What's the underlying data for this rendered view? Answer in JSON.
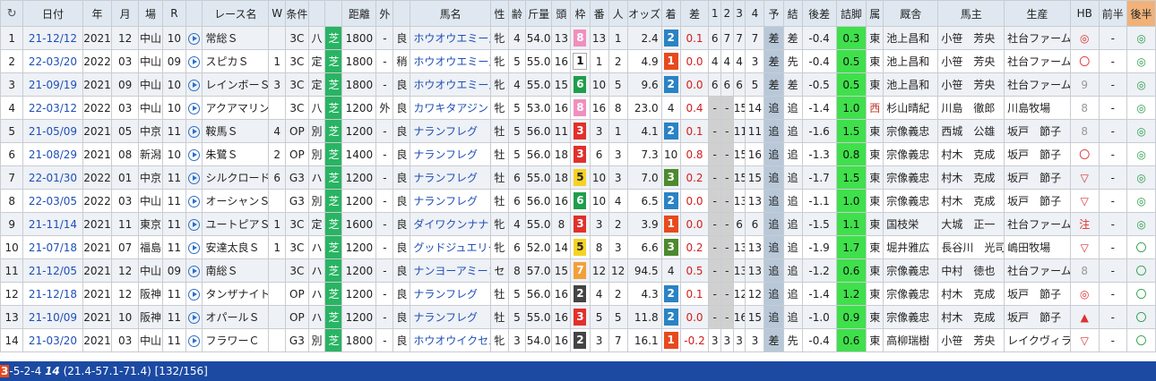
{
  "headers": {
    "refresh": "↻",
    "date": "日付",
    "year": "年",
    "month": "月",
    "place": "場",
    "race": "R",
    "race_name": "レース名",
    "w": "W",
    "cond": "条件",
    "course": "",
    "dist": "距離",
    "out": "外",
    "state": "",
    "horse": "馬名",
    "sex": "性",
    "age": "齢",
    "weight": "斤量",
    "heads": "頭",
    "waku": "枠",
    "num": "番",
    "ninki": "人",
    "odds": "オッズ",
    "chaku": "着",
    "sa": "差",
    "p1": "1",
    "p2": "2",
    "p3": "3",
    "p4": "4",
    "yoso": "予",
    "ketsu": "結",
    "kohan": "後差",
    "tsume": "詰脚",
    "zoku": "属",
    "kyusha": "厩舎",
    "owner": "馬主",
    "breeder": "生産",
    "hb": "HB",
    "zenhan": "前半",
    "kohan2": "後半"
  },
  "rows": [
    {
      "n": "1",
      "date": "21-12/12",
      "year": "2021",
      "month": "12",
      "place": "中山",
      "race": "10",
      "name": "常総Ｓ",
      "w": "",
      "cond": "3C",
      "ryo": "八",
      "course": "芝",
      "dist": "1800",
      "out": "-",
      "state": "良",
      "horse": "ホウオウエミーズ",
      "sex": "牝",
      "age": "4",
      "kin": "54.0",
      "heads": "13",
      "waku": "8",
      "num": "13",
      "ninki": "1",
      "odds": "2.4",
      "chaku": "2",
      "sa": "0.1",
      "p1": "6",
      "p2": "7",
      "p3": "7",
      "p4": "7",
      "yoso": "差",
      "ketsu": "差",
      "kohan": "-0.4",
      "tsume": "0.3",
      "zoku": "東",
      "kyusha": "池上昌和",
      "owner": "小笹　芳央",
      "breeder": "社台ファーム",
      "hb": "◎",
      "zenhan": "-",
      "kohan2": "◎"
    },
    {
      "n": "2",
      "date": "22-03/20",
      "year": "2022",
      "month": "03",
      "place": "中山",
      "race": "09",
      "name": "スピカＳ",
      "w": "1",
      "cond": "3C",
      "ryo": "定",
      "course": "芝",
      "dist": "1800",
      "out": "-",
      "state": "稍",
      "horse": "ホウオウエミーズ",
      "sex": "牝",
      "age": "5",
      "kin": "55.0",
      "heads": "16",
      "waku": "1",
      "num": "1",
      "ninki": "2",
      "odds": "4.9",
      "chaku": "1",
      "sa": "0.0",
      "p1": "4",
      "p2": "4",
      "p3": "4",
      "p4": "3",
      "yoso": "差",
      "ketsu": "先",
      "kohan": "-0.4",
      "tsume": "0.5",
      "zoku": "東",
      "kyusha": "池上昌和",
      "owner": "小笹　芳央",
      "breeder": "社台ファーム",
      "hb": "〇",
      "zenhan": "-",
      "kohan2": "◎"
    },
    {
      "n": "3",
      "date": "21-09/19",
      "year": "2021",
      "month": "09",
      "place": "中山",
      "race": "10",
      "name": "レインボーＳ",
      "w": "3",
      "cond": "3C",
      "ryo": "定",
      "course": "芝",
      "dist": "1800",
      "out": "-",
      "state": "良",
      "horse": "ホウオウエミーズ",
      "sex": "牝",
      "age": "4",
      "kin": "55.0",
      "heads": "15",
      "waku": "6",
      "num": "10",
      "ninki": "5",
      "odds": "9.6",
      "chaku": "2",
      "sa": "0.0",
      "p1": "6",
      "p2": "6",
      "p3": "6",
      "p4": "5",
      "yoso": "差",
      "ketsu": "差",
      "kohan": "-0.5",
      "tsume": "0.5",
      "zoku": "東",
      "kyusha": "池上昌和",
      "owner": "小笹　芳央",
      "breeder": "社台ファーム",
      "hb": "9",
      "zenhan": "-",
      "kohan2": "◎"
    },
    {
      "n": "4",
      "date": "22-03/12",
      "year": "2022",
      "month": "03",
      "place": "中山",
      "race": "10",
      "name": "アクアマリン",
      "w": "",
      "cond": "3C",
      "ryo": "八",
      "course": "芝",
      "dist": "1200",
      "out": "外",
      "state": "良",
      "horse": "カワキタアジン",
      "sex": "牝",
      "age": "5",
      "kin": "53.0",
      "heads": "16",
      "waku": "8",
      "num": "16",
      "ninki": "8",
      "odds": "23.0",
      "chaku": "4",
      "sa": "0.4",
      "p1": "-",
      "p2": "-",
      "p3": "15",
      "p4": "14",
      "yoso": "追",
      "ketsu": "追",
      "kohan": "-1.4",
      "tsume": "1.0",
      "zoku": "西",
      "kyusha": "杉山晴紀",
      "owner": "川島　徹郎",
      "breeder": "川島牧場",
      "hb": "8",
      "zenhan": "-",
      "kohan2": "◎"
    },
    {
      "n": "5",
      "date": "21-05/09",
      "year": "2021",
      "month": "05",
      "place": "中京",
      "race": "11",
      "name": "鞍馬Ｓ",
      "w": "4",
      "cond": "OP",
      "ryo": "別",
      "course": "芝",
      "dist": "1200",
      "out": "-",
      "state": "良",
      "horse": "ナランフレグ",
      "sex": "牡",
      "age": "5",
      "kin": "56.0",
      "heads": "11",
      "waku": "3",
      "num": "3",
      "ninki": "1",
      "odds": "4.1",
      "chaku": "2",
      "sa": "0.1",
      "p1": "-",
      "p2": "-",
      "p3": "11",
      "p4": "11",
      "yoso": "追",
      "ketsu": "追",
      "kohan": "-1.6",
      "tsume": "1.5",
      "zoku": "東",
      "kyusha": "宗像義忠",
      "owner": "西城　公雄",
      "breeder": "坂戸　節子",
      "hb": "8",
      "zenhan": "-",
      "kohan2": "◎"
    },
    {
      "n": "6",
      "date": "21-08/29",
      "year": "2021",
      "month": "08",
      "place": "新潟",
      "race": "10",
      "name": "朱鷺Ｓ",
      "w": "2",
      "cond": "OP",
      "ryo": "別",
      "course": "芝",
      "dist": "1400",
      "out": "-",
      "state": "良",
      "horse": "ナランフレグ",
      "sex": "牡",
      "age": "5",
      "kin": "56.0",
      "heads": "18",
      "waku": "3",
      "num": "6",
      "ninki": "3",
      "odds": "7.3",
      "chaku": "10",
      "sa": "0.8",
      "p1": "-",
      "p2": "-",
      "p3": "15",
      "p4": "16",
      "yoso": "追",
      "ketsu": "追",
      "kohan": "-1.3",
      "tsume": "0.8",
      "zoku": "東",
      "kyusha": "宗像義忠",
      "owner": "村木　克成",
      "breeder": "坂戸　節子",
      "hb": "〇",
      "zenhan": "-",
      "kohan2": "◎"
    },
    {
      "n": "7",
      "date": "22-01/30",
      "year": "2022",
      "month": "01",
      "place": "中京",
      "race": "11",
      "name": "シルクロード",
      "w": "6",
      "cond": "G3",
      "ryo": "ハ",
      "course": "芝",
      "dist": "1200",
      "out": "-",
      "state": "良",
      "horse": "ナランフレグ",
      "sex": "牡",
      "age": "6",
      "kin": "55.0",
      "heads": "18",
      "waku": "5",
      "num": "10",
      "ninki": "3",
      "odds": "7.0",
      "chaku": "3",
      "sa": "0.2",
      "p1": "-",
      "p2": "-",
      "p3": "15",
      "p4": "15",
      "yoso": "追",
      "ketsu": "追",
      "kohan": "-1.7",
      "tsume": "1.5",
      "zoku": "東",
      "kyusha": "宗像義忠",
      "owner": "村木　克成",
      "breeder": "坂戸　節子",
      "hb": "▽",
      "zenhan": "-",
      "kohan2": "◎"
    },
    {
      "n": "8",
      "date": "22-03/05",
      "year": "2022",
      "month": "03",
      "place": "中山",
      "race": "11",
      "name": "オーシャンＳ",
      "w": "",
      "cond": "G3",
      "ryo": "別",
      "course": "芝",
      "dist": "1200",
      "out": "-",
      "state": "良",
      "horse": "ナランフレグ",
      "sex": "牡",
      "age": "6",
      "kin": "56.0",
      "heads": "16",
      "waku": "6",
      "num": "10",
      "ninki": "4",
      "odds": "6.5",
      "chaku": "2",
      "sa": "0.0",
      "p1": "-",
      "p2": "-",
      "p3": "13",
      "p4": "13",
      "yoso": "追",
      "ketsu": "追",
      "kohan": "-1.1",
      "tsume": "1.0",
      "zoku": "東",
      "kyusha": "宗像義忠",
      "owner": "村木　克成",
      "breeder": "坂戸　節子",
      "hb": "▽",
      "zenhan": "-",
      "kohan2": "◎"
    },
    {
      "n": "9",
      "date": "21-11/14",
      "year": "2021",
      "month": "11",
      "place": "東京",
      "race": "11",
      "name": "ユートピアＳ",
      "w": "1",
      "cond": "3C",
      "ryo": "定",
      "course": "芝",
      "dist": "1600",
      "out": "-",
      "state": "良",
      "horse": "ダイワクンナナ",
      "sex": "牝",
      "age": "4",
      "kin": "55.0",
      "heads": "8",
      "waku": "3",
      "num": "3",
      "ninki": "2",
      "odds": "3.9",
      "chaku": "1",
      "sa": "0.0",
      "p1": "-",
      "p2": "-",
      "p3": "6",
      "p4": "6",
      "yoso": "追",
      "ketsu": "追",
      "kohan": "-1.5",
      "tsume": "1.1",
      "zoku": "東",
      "kyusha": "国枝栄",
      "owner": "大城　正一",
      "breeder": "社台ファーム",
      "hb": "注",
      "zenhan": "-",
      "kohan2": "◎"
    },
    {
      "n": "10",
      "date": "21-07/18",
      "year": "2021",
      "month": "07",
      "place": "福島",
      "race": "11",
      "name": "安達太良Ｓ",
      "w": "1",
      "cond": "3C",
      "ryo": "ハ",
      "course": "芝",
      "dist": "1200",
      "out": "-",
      "state": "良",
      "horse": "グッドジュエリー",
      "sex": "牝",
      "age": "6",
      "kin": "52.0",
      "heads": "14",
      "waku": "5",
      "num": "8",
      "ninki": "3",
      "odds": "6.6",
      "chaku": "3",
      "sa": "0.2",
      "p1": "-",
      "p2": "-",
      "p3": "13",
      "p4": "13",
      "yoso": "追",
      "ketsu": "追",
      "kohan": "-1.9",
      "tsume": "1.7",
      "zoku": "東",
      "kyusha": "堀井雅広",
      "owner": "長谷川　光司",
      "breeder": "嶋田牧場",
      "hb": "▽",
      "zenhan": "-",
      "kohan2": "〇"
    },
    {
      "n": "11",
      "date": "21-12/05",
      "year": "2021",
      "month": "12",
      "place": "中山",
      "race": "09",
      "name": "南総Ｓ",
      "w": "",
      "cond": "3C",
      "ryo": "ハ",
      "course": "芝",
      "dist": "1200",
      "out": "-",
      "state": "良",
      "horse": "ナンヨーアミーコ",
      "sex": "セ",
      "age": "8",
      "kin": "57.0",
      "heads": "15",
      "waku": "7",
      "num": "12",
      "ninki": "12",
      "odds": "94.5",
      "chaku": "4",
      "sa": "0.5",
      "p1": "-",
      "p2": "-",
      "p3": "13",
      "p4": "13",
      "yoso": "追",
      "ketsu": "追",
      "kohan": "-1.2",
      "tsume": "0.6",
      "zoku": "東",
      "kyusha": "宗像義忠",
      "owner": "中村　徳也",
      "breeder": "社台ファーム",
      "hb": "8",
      "zenhan": "-",
      "kohan2": "〇"
    },
    {
      "n": "12",
      "date": "21-12/18",
      "year": "2021",
      "month": "12",
      "place": "阪神",
      "race": "11",
      "name": "タンザナイト",
      "w": "",
      "cond": "OP",
      "ryo": "ハ",
      "course": "芝",
      "dist": "1200",
      "out": "-",
      "state": "良",
      "horse": "ナランフレグ",
      "sex": "牡",
      "age": "5",
      "kin": "56.0",
      "heads": "16",
      "waku": "2",
      "num": "4",
      "ninki": "2",
      "odds": "4.3",
      "chaku": "2",
      "sa": "0.1",
      "p1": "-",
      "p2": "-",
      "p3": "12",
      "p4": "12",
      "yoso": "追",
      "ketsu": "追",
      "kohan": "-1.4",
      "tsume": "1.2",
      "zoku": "東",
      "kyusha": "宗像義忠",
      "owner": "村木　克成",
      "breeder": "坂戸　節子",
      "hb": "◎",
      "zenhan": "-",
      "kohan2": "〇"
    },
    {
      "n": "13",
      "date": "21-10/09",
      "year": "2021",
      "month": "10",
      "place": "阪神",
      "race": "11",
      "name": "オパールＳ",
      "w": "",
      "cond": "OP",
      "ryo": "ハ",
      "course": "芝",
      "dist": "1200",
      "out": "-",
      "state": "良",
      "horse": "ナランフレグ",
      "sex": "牡",
      "age": "5",
      "kin": "55.0",
      "heads": "16",
      "waku": "3",
      "num": "5",
      "ninki": "5",
      "odds": "11.8",
      "chaku": "2",
      "sa": "0.0",
      "p1": "-",
      "p2": "-",
      "p3": "16",
      "p4": "15",
      "yoso": "追",
      "ketsu": "追",
      "kohan": "-1.0",
      "tsume": "0.9",
      "zoku": "東",
      "kyusha": "宗像義忠",
      "owner": "村木　克成",
      "breeder": "坂戸　節子",
      "hb": "▲",
      "zenhan": "-",
      "kohan2": "〇"
    },
    {
      "n": "14",
      "date": "21-03/20",
      "year": "2021",
      "month": "03",
      "place": "中山",
      "race": "11",
      "name": "フラワーＣ",
      "w": "",
      "cond": "G3",
      "ryo": "別",
      "course": "芝",
      "dist": "1800",
      "out": "-",
      "state": "良",
      "horse": "ホウオウイクセル",
      "sex": "牝",
      "age": "3",
      "kin": "54.0",
      "heads": "16",
      "waku": "2",
      "num": "3",
      "ninki": "7",
      "odds": "16.1",
      "chaku": "1",
      "sa": "-0.2",
      "p1": "3",
      "p2": "3",
      "p3": "3",
      "p4": "3",
      "yoso": "差",
      "ketsu": "先",
      "kohan": "-0.4",
      "tsume": "0.6",
      "zoku": "東",
      "kyusha": "高柳瑞樹",
      "owner": "小笹　芳央",
      "breeder": "レイクヴィラ",
      "hb": "▽",
      "zenhan": "-",
      "kohan2": "〇"
    }
  ],
  "status": {
    "highlight": "3",
    "text1": "-5-2-4 ",
    "total": "14",
    "text2": " (21.4-57.1-71.4) [132/156]"
  },
  "colors": {
    "status_bg": "#1c4aa3",
    "turf": "#28b463",
    "header_bg": "#dfe8f1"
  }
}
